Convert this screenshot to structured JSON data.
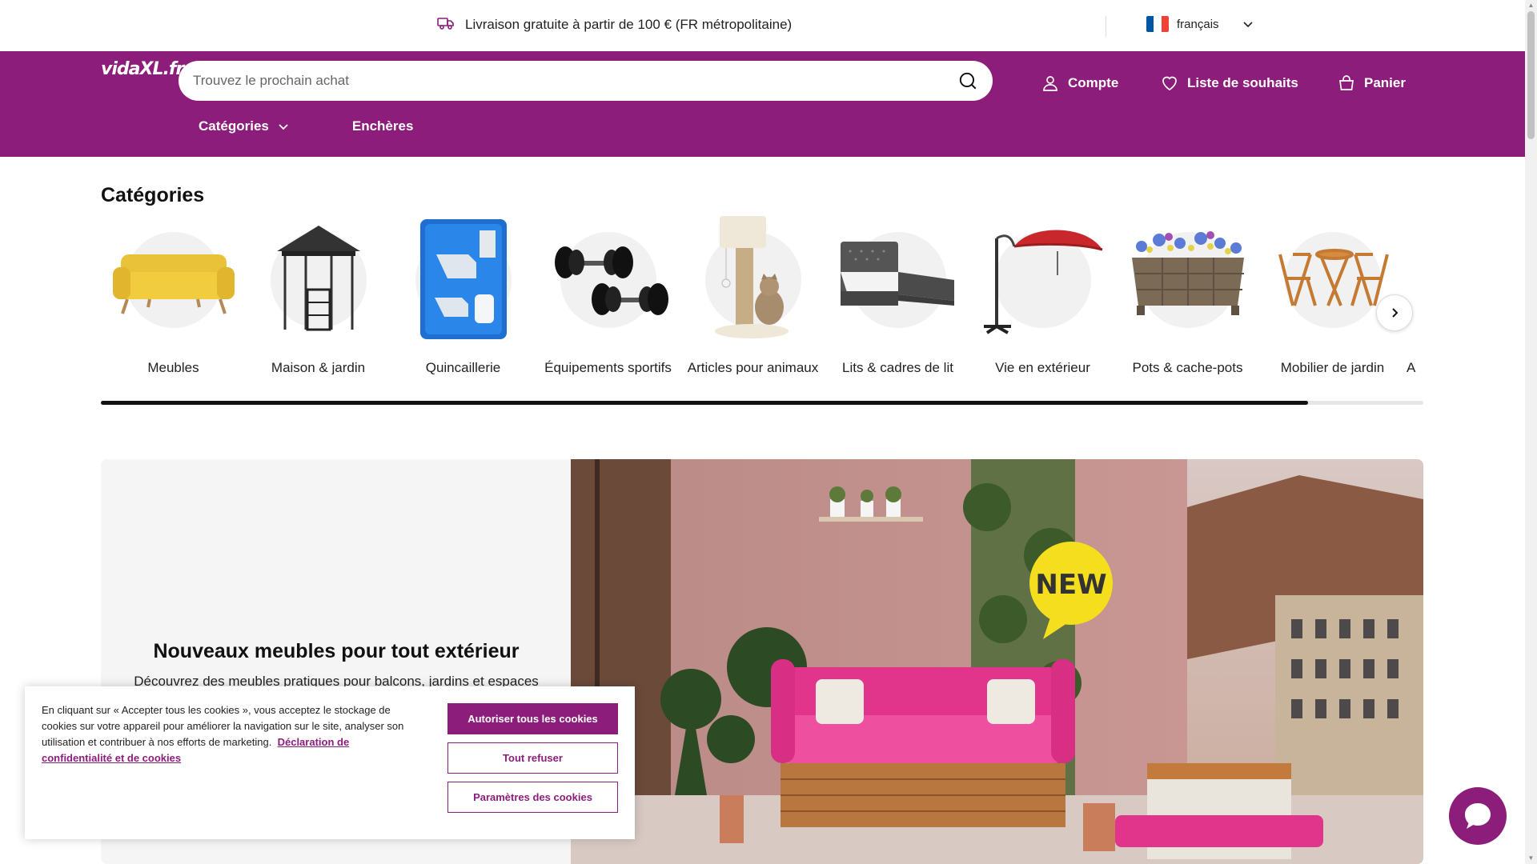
{
  "topbar": {
    "promo_text": "Livraison gratuite à partir de 100 € (FR métropolitaine)",
    "promo_icon": "delivery-truck-icon",
    "language": "français",
    "language_flag_colors": [
      "#0055a4",
      "#ffffff",
      "#ef4135"
    ]
  },
  "header": {
    "logo": "vidaXL.fr",
    "search_placeholder": "Trouvez le prochain achat",
    "account_label": "Compte",
    "wishlist_label": "Liste de souhaits",
    "cart_label": "Panier",
    "subnav": {
      "categories_label": "Catégories",
      "auctions_label": "Enchères"
    }
  },
  "categories": {
    "title": "Catégories",
    "items": [
      {
        "label": "Meubles",
        "icon": "sofa-icon"
      },
      {
        "label": "Maison & jardin",
        "icon": "gazebo-icon"
      },
      {
        "label": "Quincaillerie",
        "icon": "toolbox-icon"
      },
      {
        "label": "Équipements sportifs",
        "icon": "dumbbell-icon"
      },
      {
        "label": "Articles pour animaux",
        "icon": "cat-tree-icon"
      },
      {
        "label": "Lits & cadres de lit",
        "icon": "bed-icon"
      },
      {
        "label": "Vie en extérieur",
        "icon": "parasol-icon"
      },
      {
        "label": "Pots & cache-pots",
        "icon": "planter-icon"
      },
      {
        "label": "Mobilier de jardin",
        "icon": "bistro-set-icon"
      },
      {
        "label": "A",
        "icon": "partial-item"
      }
    ],
    "scroll_progress": 0.913
  },
  "hero": {
    "title": "Nouveaux meubles pour tout extérieur",
    "subtitle": "Découvrez des meubles pratiques pour balcons, jardins et espaces",
    "badge": "NEW"
  },
  "cookie_banner": {
    "text": "En cliquant sur « Accepter tous les cookies », vous acceptez le stockage de cookies sur votre appareil pour améliorer la navigation sur le site, analyser son utilisation et contribuer à nos efforts de marketing.",
    "link_text": "Déclaration de confidentialité et de cookies",
    "accept_label": "Autoriser tous les cookies",
    "reject_label": "Tout refuser",
    "settings_label": "Paramètres des cookies"
  },
  "colors": {
    "brand": "#8c1d7a",
    "text": "#111111"
  }
}
